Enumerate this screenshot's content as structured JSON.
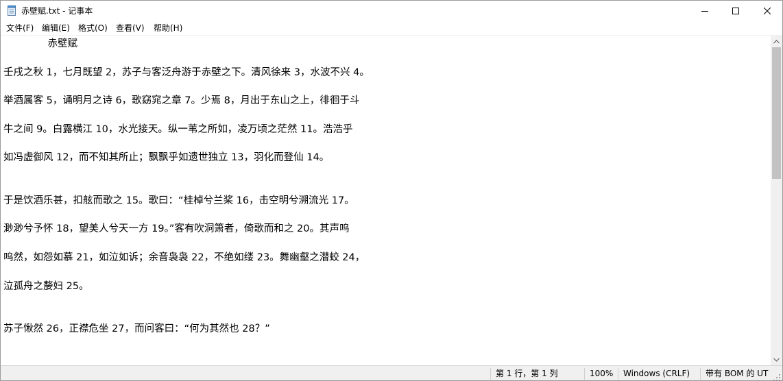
{
  "window": {
    "title": "赤壁赋.txt - 记事本"
  },
  "menu": {
    "items": [
      "文件(F)",
      "编辑(E)",
      "格式(O)",
      "查看(V)",
      "帮助(H)"
    ]
  },
  "document": {
    "lines": [
      "              赤壁赋",
      "",
      "壬戌之秋 1，七月既望 2，苏子与客泛舟游于赤壁之下。清风徐来 3，水波不兴 4。",
      "",
      "举酒属客 5，诵明月之诗 6，歌窈窕之章 7。少焉 8，月出于东山之上，徘徊于斗",
      "",
      "牛之间 9。白露横江 10，水光接天。纵一苇之所如，凌万顷之茫然 11。浩浩乎",
      "",
      "如冯虚御风 12，而不知其所止；飘飘乎如遗世独立 13，羽化而登仙 14。",
      "",
      "",
      "于是饮酒乐甚，扣舷而歌之 15。歌曰：“桂棹兮兰桨 16，击空明兮溯流光 17。",
      "",
      "渺渺兮予怀 18，望美人兮天一方 19。”客有吹洞箫者，倚歌而和之 20。其声呜",
      "",
      "呜然，如怨如慕 21，如泣如诉；余音袅袅 22，不绝如缕 23。舞幽壑之潜蛟 24，",
      "",
      "泣孤舟之嫠妇 25。",
      "",
      "",
      "苏子愀然 26，正襟危坐 27，而问客曰：“何为其然也 28？”"
    ]
  },
  "statusbar": {
    "position": "第 1 行，第 1 列",
    "zoom": "100%",
    "line_ending": "Windows (CRLF)",
    "encoding": "带有 BOM 的 UT"
  },
  "icons": {
    "app": "notepad-icon",
    "minimize": "minimize-icon",
    "maximize": "maximize-icon",
    "close": "close-icon",
    "scroll_up": "chevron-up-icon",
    "scroll_down": "chevron-down-icon",
    "grip": "resize-grip-icon"
  },
  "colors": {
    "status_bg": "#f0f0f0",
    "scroll_thumb": "#c2c2c2",
    "text": "#000000"
  }
}
